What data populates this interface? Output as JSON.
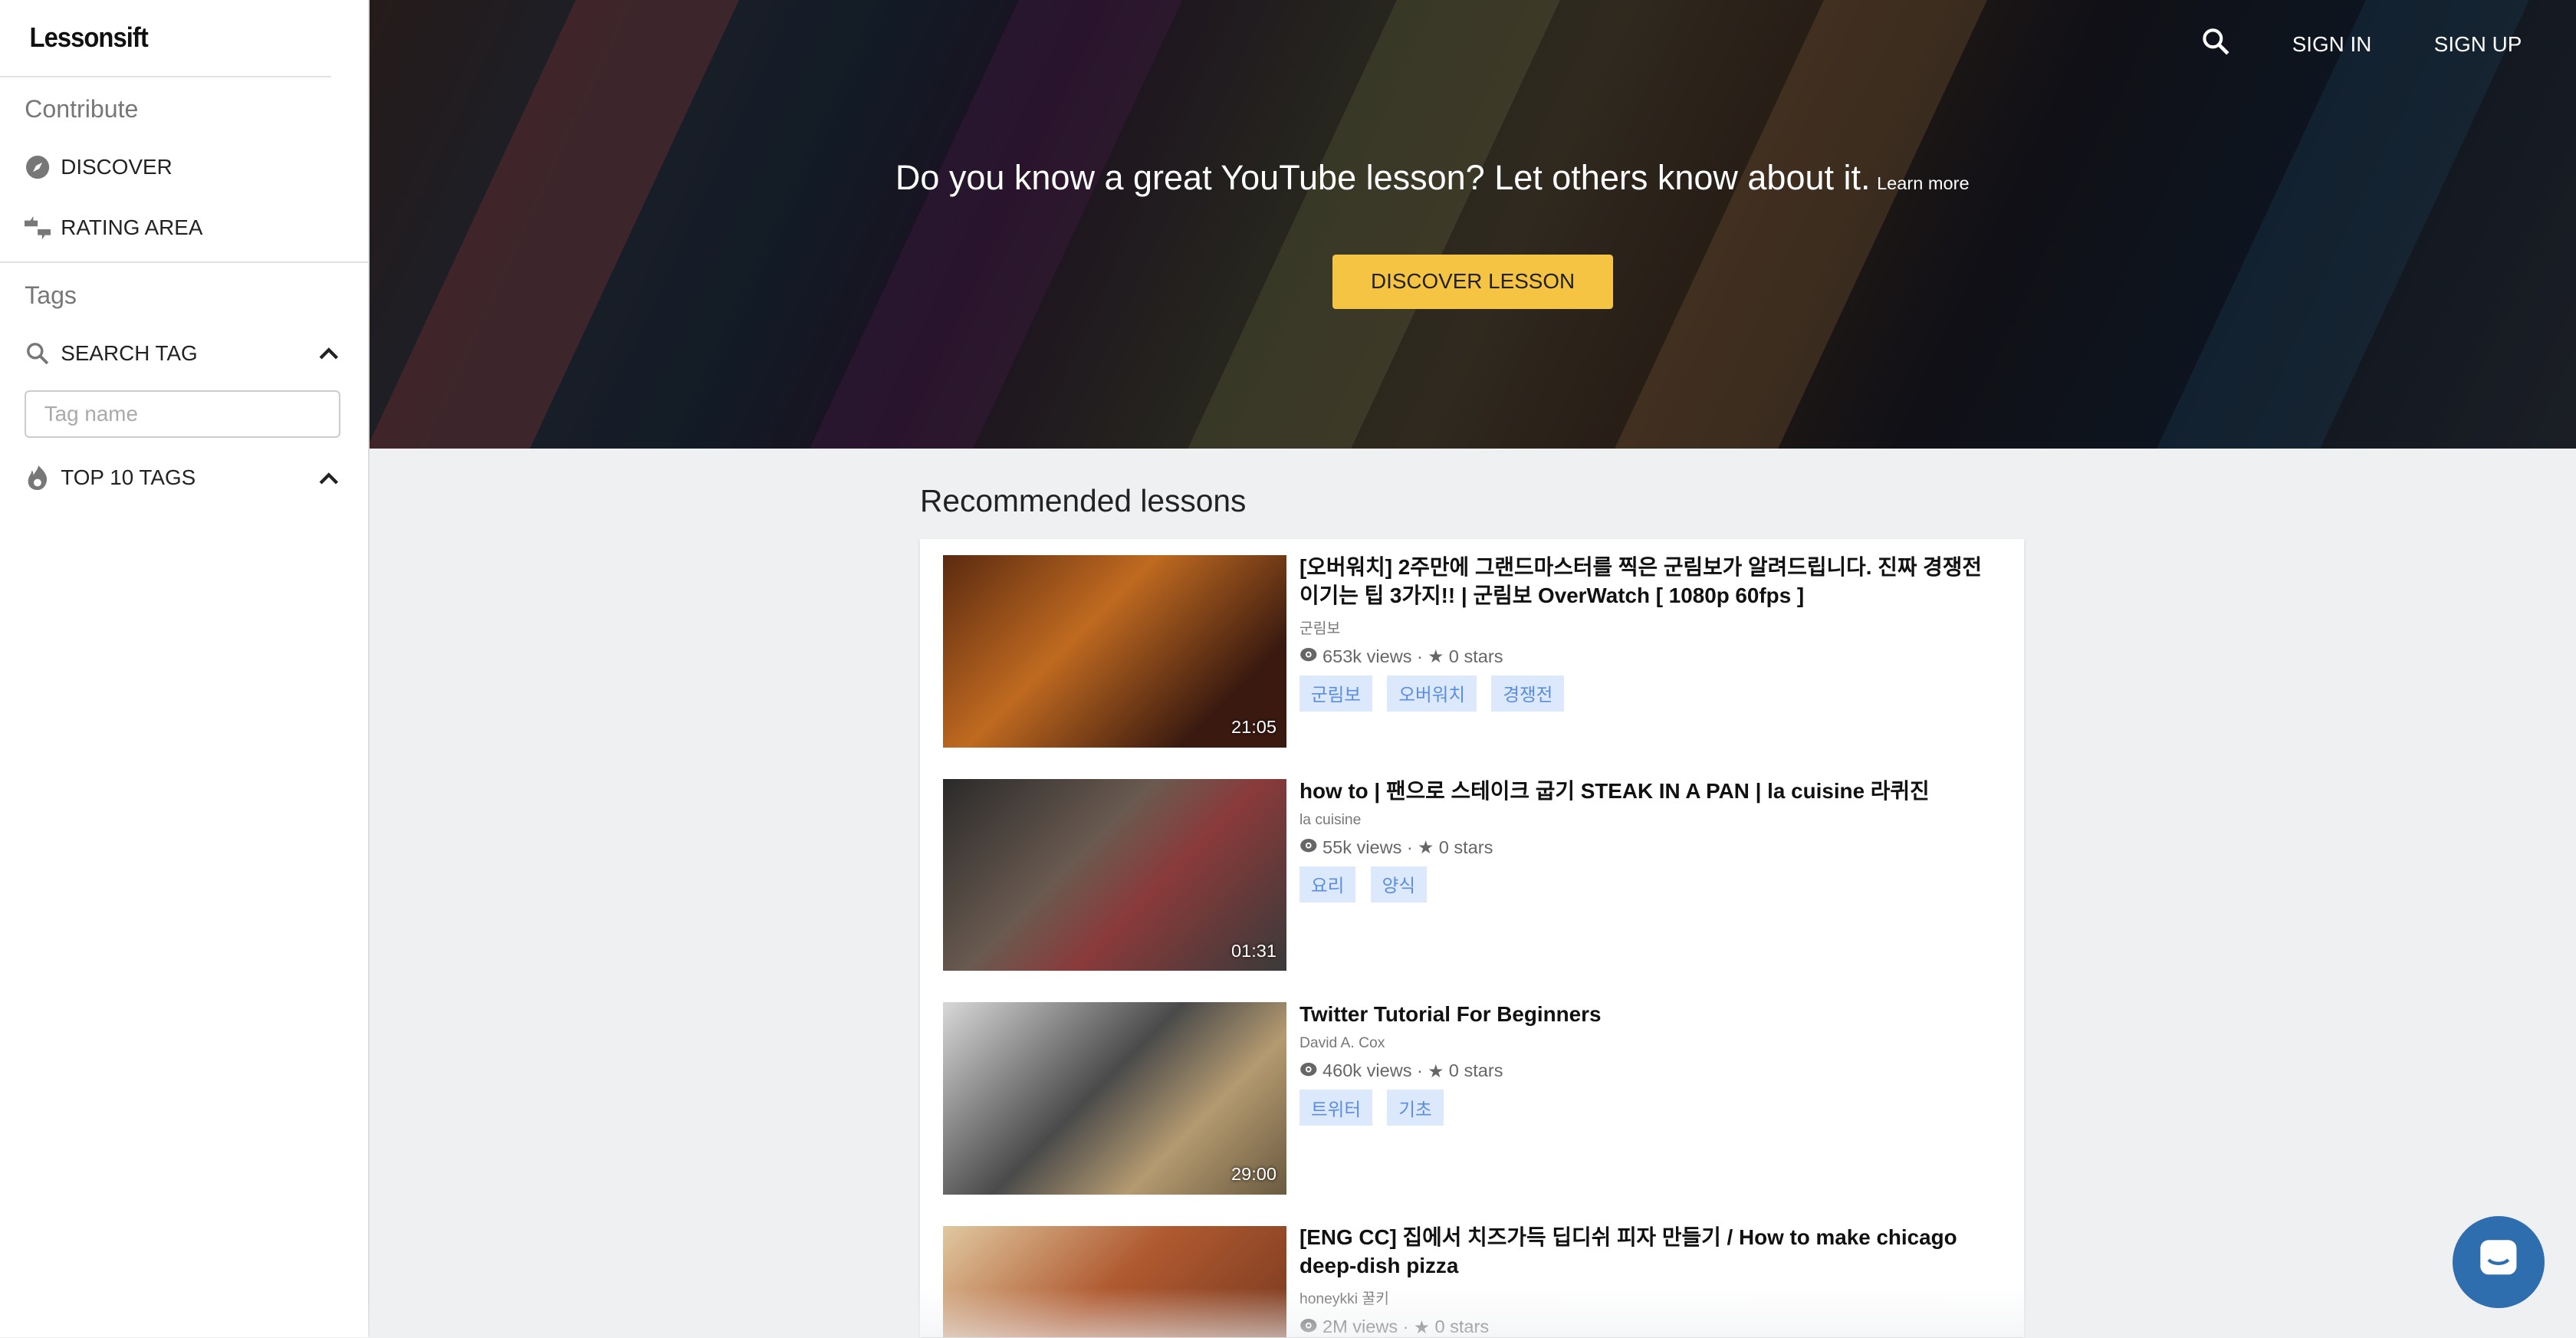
{
  "sidebar": {
    "logo": "Lessonsift",
    "contribute": "Contribute",
    "discover": "DISCOVER",
    "rating_area": "RATING AREA",
    "tags": "Tags",
    "search_tag": "SEARCH TAG",
    "tag_placeholder": "Tag name",
    "top10": "TOP 10 TAGS"
  },
  "header": {
    "sign_in": "SIGN IN",
    "sign_up": "SIGN UP",
    "message": "Do you know a great YouTube lesson? Let others know about it.",
    "learn_more": "Learn more",
    "discover_button": "DISCOVER LESSON"
  },
  "main": {
    "section_title": "Recommended lessons",
    "lessons": [
      {
        "title": "[오버워치] 2주만에 그랜드마스터를 찍은 군림보가 알려드립니다. 진짜 경쟁전 이기는 팁 3가지!! | 군림보 OverWatch [ 1080p 60fps ]",
        "channel": "군림보",
        "views": "653k views",
        "stars": "0 stars",
        "duration": "21:05",
        "tags": [
          "군림보",
          "오버워치",
          "경쟁전"
        ]
      },
      {
        "title": "how to | 팬으로 스테이크 굽기 STEAK IN A PAN | la cuisine 라퀴진",
        "channel": "la cuisine",
        "views": "55k views",
        "stars": "0 stars",
        "duration": "01:31",
        "tags": [
          "요리",
          "양식"
        ]
      },
      {
        "title": "Twitter Tutorial For Beginners",
        "channel": "David A. Cox",
        "views": "460k views",
        "stars": "0 stars",
        "duration": "29:00",
        "tags": [
          "트위터",
          "기초"
        ]
      },
      {
        "title": "[ENG CC] 집에서 치즈가득 딥디쉬 피자 만들기 / How to make chicago deep-dish pizza",
        "channel": "honeykki 꿀키",
        "views": "2M views",
        "stars": "0 stars",
        "tags": []
      }
    ]
  },
  "colors": {
    "accent": "#f5c443",
    "tag_bg": "#dce8fb",
    "tag_text": "#5b8de0",
    "chat": "#2f6eae"
  }
}
